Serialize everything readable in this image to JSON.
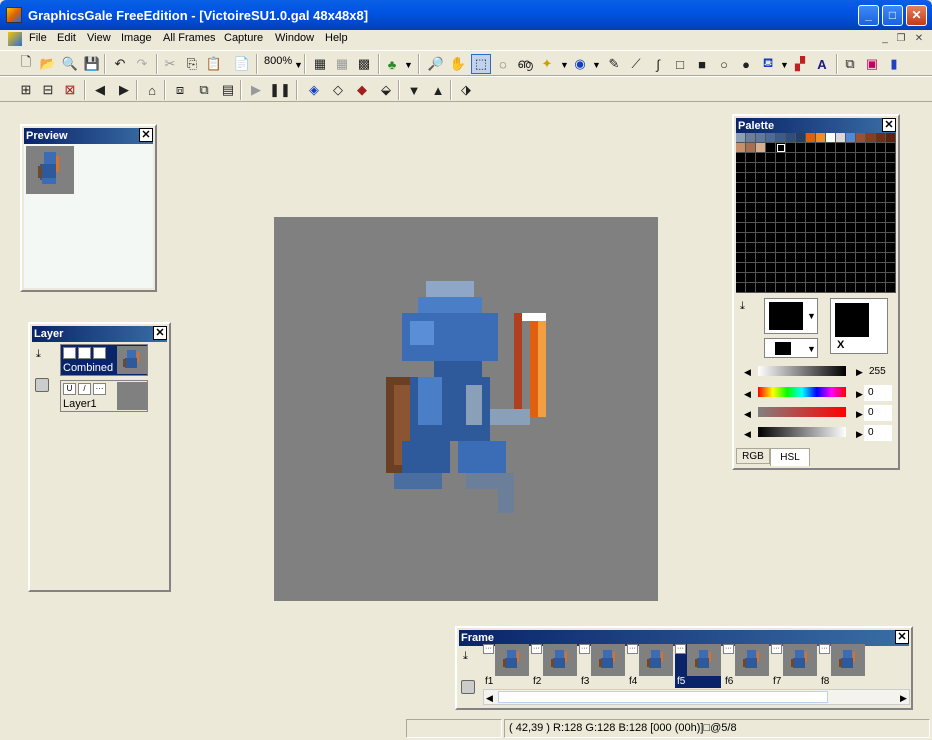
{
  "window": {
    "title": "GraphicsGale FreeEdition - [VictoireSU1.0.gal 48x48x8]"
  },
  "menu": [
    "File",
    "Edit",
    "View",
    "Image",
    "All Frames",
    "Capture",
    "Window",
    "Help"
  ],
  "toolbar": {
    "zoom": "800%"
  },
  "preview": {
    "title": "Preview"
  },
  "layer": {
    "title": "Layer",
    "rows": [
      {
        "name": "Combined"
      },
      {
        "name": "Layer1"
      }
    ]
  },
  "palette": {
    "title": "Palette",
    "tabs": [
      "RGB",
      "HSL"
    ],
    "values": {
      "top": "255",
      "hue": "0",
      "sat": "0",
      "lum": "0"
    },
    "swatch_x": "X",
    "top_row": [
      "#8aa0b8",
      "#6c7f9a",
      "#5f7a9f",
      "#4e6b95",
      "#3d5c85",
      "#2f4f78",
      "#263f66",
      "#e06010",
      "#f09020",
      "#ffffff",
      "#d8d8d8",
      "#4f8ad9",
      "#a05030",
      "#8a3c20",
      "#703018",
      "#582410"
    ],
    "second_row": [
      "#c89068",
      "#a87050",
      "#d8b090",
      "#000000"
    ]
  },
  "frames": {
    "title": "Frame",
    "items": [
      "f1",
      "f2",
      "f3",
      "f4",
      "f5",
      "f6",
      "f7",
      "f8"
    ],
    "selected": "f5"
  },
  "status": {
    "info": "( 42,39 ) R:128 G:128 B:128  [000 (00h)]□@5/8"
  }
}
